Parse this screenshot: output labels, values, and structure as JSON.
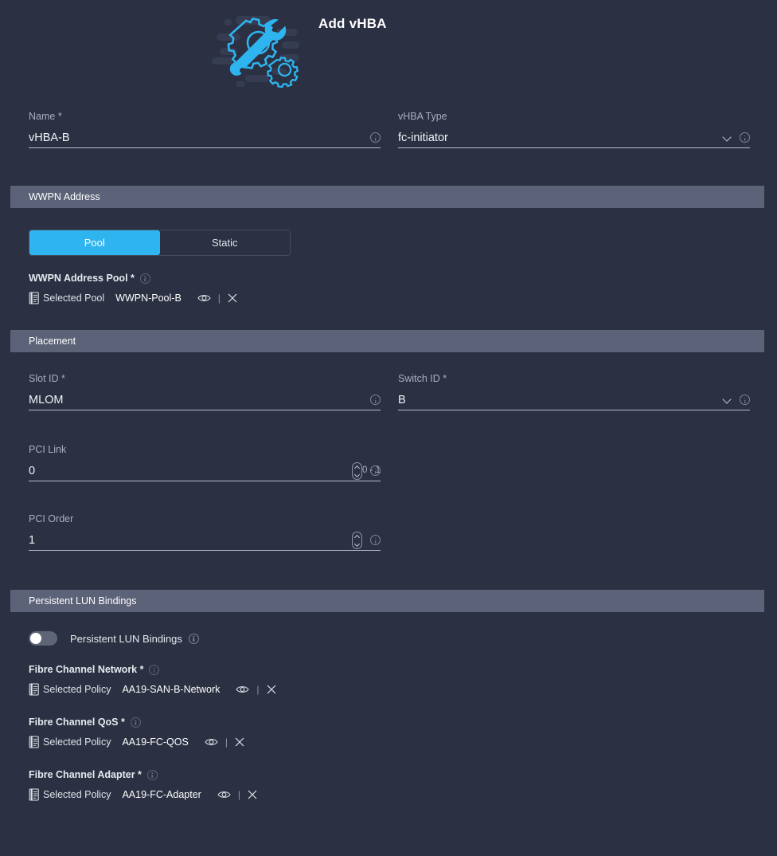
{
  "header": {
    "title": "Add vHBA",
    "icon": "gear-wrench-icon"
  },
  "colors": {
    "background": "#2b3042",
    "section_bar": "#5c6277",
    "accent": "#2eb4ef",
    "text": "#e7eaf0",
    "muted_text": "#a8b0c0",
    "underline": "#b9bfcd"
  },
  "basic": {
    "name": {
      "label": "Name *",
      "value": "vHBA-B",
      "placeholder": "Name"
    },
    "vhba_type": {
      "label": "vHBA Type",
      "value": "fc-initiator",
      "placeholder": "vHBA Type"
    }
  },
  "wwpn_section": {
    "title": "WWPN Address",
    "segmented": {
      "options": [
        "Pool",
        "Static"
      ],
      "selected": "Pool"
    },
    "pool": {
      "label": "WWPN Address Pool *",
      "kind": "Selected Pool",
      "value": "WWPN-Pool-B",
      "view_action": "view-icon",
      "clear_action": "clear-icon"
    }
  },
  "placement_section": {
    "title": "Placement",
    "slot_id": {
      "label": "Slot ID *",
      "value": "MLOM",
      "placeholder": "Slot ID"
    },
    "switch_id": {
      "label": "Switch ID *",
      "value": "B",
      "placeholder": "Switch ID"
    },
    "pci_link": {
      "label": "PCI Link",
      "value": "0",
      "hint": "0 - 1",
      "placeholder": "PCI Link"
    },
    "pci_order": {
      "label": "PCI Order",
      "value": "1",
      "placeholder": "PCI Order"
    }
  },
  "lun_section": {
    "title": "Persistent LUN Bindings",
    "toggle": {
      "label": "Persistent LUN Bindings",
      "state": "off"
    },
    "fibre_channel_network": {
      "label": "Fibre Channel Network *",
      "kind": "Selected Policy",
      "value": "AA19-SAN-B-Network"
    },
    "fibre_channel_qos": {
      "label": "Fibre Channel QoS *",
      "kind": "Selected Policy",
      "value": "AA19-FC-QOS"
    },
    "fibre_channel_adapter": {
      "label": "Fibre Channel Adapter *",
      "kind": "Selected Policy",
      "value": "AA19-FC-Adapter"
    }
  },
  "common": {
    "pipe": "|"
  }
}
